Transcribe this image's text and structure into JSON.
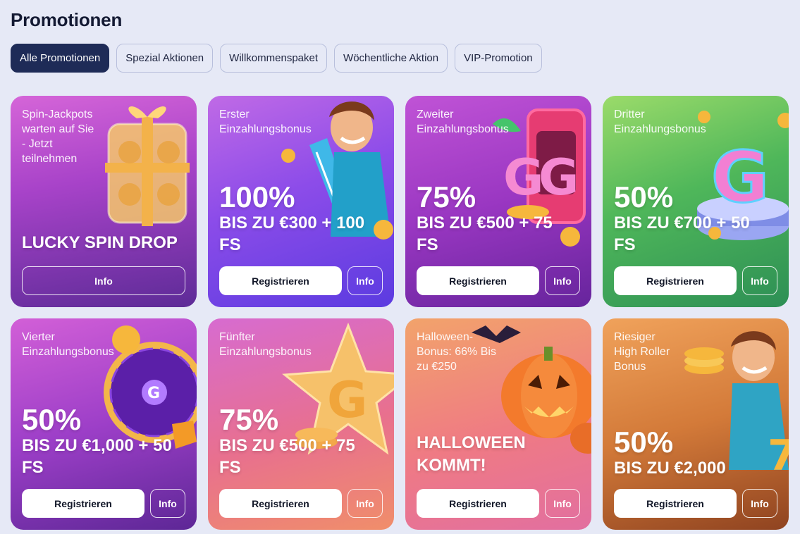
{
  "page": {
    "title": "Promotionen"
  },
  "tabs": [
    {
      "label": "Alle Promotionen",
      "active": true
    },
    {
      "label": "Spezial Aktionen",
      "active": false
    },
    {
      "label": "Willkommenspaket",
      "active": false
    },
    {
      "label": "Wöchentliche Aktion",
      "active": false
    },
    {
      "label": "VIP-Promotion",
      "active": false
    }
  ],
  "buttons": {
    "register": "Registrieren",
    "info": "Info"
  },
  "cards": [
    {
      "subtitle": "Spin-Jackpots\nwarten auf Sie\n- Jetzt\nteilnehmen",
      "headline": "LUCKY SPIN DROP",
      "art": "gift-box-icon"
    },
    {
      "subtitle": "Erster\nEinzahlungsbonus",
      "big": "100%",
      "small": "BIS ZU €300 + 100\nFS",
      "art": "surfer-character-icon"
    },
    {
      "subtitle": "Zweiter\nEinzahlungsbonus",
      "big": "75%",
      "small": "BIS ZU €500 + 75\nFS",
      "art": "slot-machine-icon"
    },
    {
      "subtitle": "Dritter\nEinzahlungsbonus",
      "big": "50%",
      "small": "BIS ZU €700 + 50\nFS",
      "art": "g-logo-pedestal-icon"
    },
    {
      "subtitle": "Vierter\nEinzahlungsbonus",
      "big": "50%",
      "small": "BIS ZU €1,000 + 50\nFS",
      "art": "prize-wheel-icon"
    },
    {
      "subtitle": "Fünfter\nEinzahlungsbonus",
      "big": "75%",
      "small": "BIS ZU €500 + 75\nFS",
      "art": "star-g-icon"
    },
    {
      "subtitle": "Halloween-\nBonus: 66% Bis\nzu €250",
      "headline": "HALLOWEEN\nKOMMT!",
      "art": "pumpkin-icon"
    },
    {
      "subtitle": "Riesiger\nHigh Roller\nBonus",
      "big": "50%",
      "small": "BIS ZU €2,000",
      "art": "high-roller-character-icon"
    }
  ],
  "colors": {
    "background": "#e6e9f6",
    "active_tab": "#1e2b57",
    "button_white": "#ffffff"
  }
}
